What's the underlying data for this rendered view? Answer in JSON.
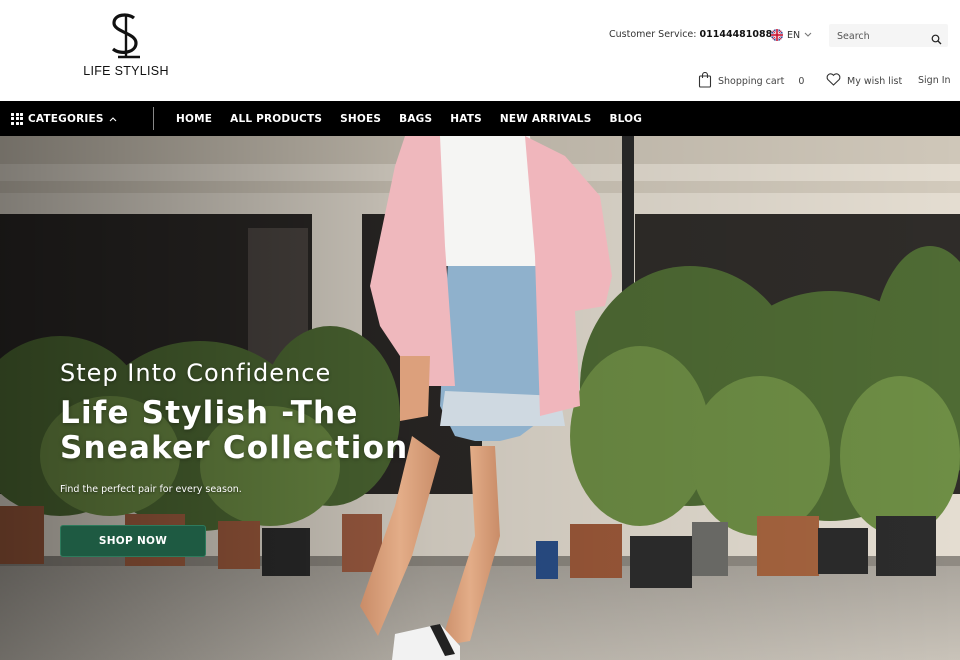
{
  "brand": {
    "name": "LIFE STYLISH"
  },
  "header": {
    "customer_service_label": "Customer Service:",
    "customer_service_phone": "01144481088",
    "language": "EN",
    "search_placeholder": "Search",
    "cart_label": "Shopping cart",
    "cart_count": "0",
    "wishlist_label": "My wish list",
    "signin_label": "Sign In"
  },
  "nav": {
    "categories_label": "CATEGORIES",
    "items": [
      {
        "label": "HOME"
      },
      {
        "label": "ALL PRODUCTS"
      },
      {
        "label": "SHOES"
      },
      {
        "label": "BAGS"
      },
      {
        "label": "HATS"
      },
      {
        "label": "NEW ARRIVALS"
      },
      {
        "label": "BLOG"
      }
    ]
  },
  "hero": {
    "subtitle": "Step Into Confidence",
    "title": "Life Stylish -The Sneaker Collection",
    "description": "Find the perfect pair for every season.",
    "cta_label": "SHOP NOW"
  },
  "colors": {
    "nav_bg": "#000000",
    "cta_bg": "#1e5a42",
    "header_bg": "#ffffff"
  },
  "icons": [
    "grid-icon",
    "chevron-up-icon",
    "flag-uk-icon",
    "chevron-down-icon",
    "search-icon",
    "shopping-bag-icon",
    "heart-icon"
  ]
}
